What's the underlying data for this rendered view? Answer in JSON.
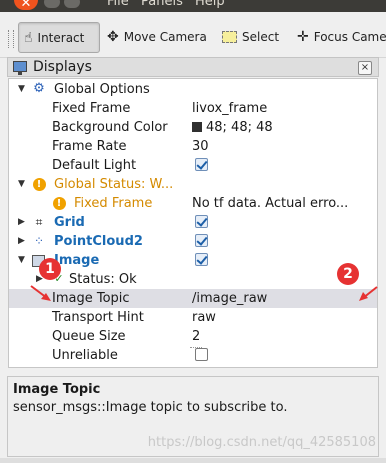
{
  "menubar": {
    "close_glyph": "✕",
    "items": [
      "File",
      "Panels",
      "Help"
    ]
  },
  "toolbar": {
    "tools": [
      {
        "label": "Interact",
        "icon": "hand-pointer-icon",
        "active": true
      },
      {
        "label": "Move Camera",
        "icon": "move-camera-icon",
        "active": false
      },
      {
        "label": "Select",
        "icon": "select-box-icon",
        "active": false
      },
      {
        "label": "Focus Camera",
        "icon": "focus-camera-icon",
        "active": false
      }
    ]
  },
  "displays": {
    "title": "Displays",
    "close_glyph": "×",
    "rows": [
      {
        "name": "Global Options",
        "value": ""
      },
      {
        "name": "Fixed Frame",
        "value": "livox_frame"
      },
      {
        "name": "Background Color",
        "value": "48; 48; 48"
      },
      {
        "name": "Frame Rate",
        "value": "30"
      },
      {
        "name": "Default Light",
        "value": ""
      },
      {
        "name": "Global Status: W...",
        "value": ""
      },
      {
        "name": "Fixed Frame",
        "value": "No tf data.  Actual erro..."
      },
      {
        "name": "Grid",
        "value": ""
      },
      {
        "name": "PointCloud2",
        "value": ""
      },
      {
        "name": "Image",
        "value": ""
      },
      {
        "name": "Status: Ok",
        "value": ""
      },
      {
        "name": "Image Topic",
        "value": "/image_raw"
      },
      {
        "name": "Transport Hint",
        "value": "raw"
      },
      {
        "name": "Queue Size",
        "value": "2"
      },
      {
        "name": "Unreliable",
        "value": ""
      }
    ],
    "checked": {
      "default_light": true,
      "grid": true,
      "pointcloud2": true,
      "image": true,
      "unreliable": false
    }
  },
  "annotations": {
    "badge1": "1",
    "badge2": "2"
  },
  "description": {
    "title": "Image Topic",
    "text": "sensor_msgs::Image topic to subscribe to."
  },
  "watermark": "https://blog.csdn.net/qq_42585108",
  "colors": {
    "accent": "#1a6ab3",
    "warning": "#d48a00",
    "annotation": "#e63232",
    "selection": "#dedee4"
  }
}
